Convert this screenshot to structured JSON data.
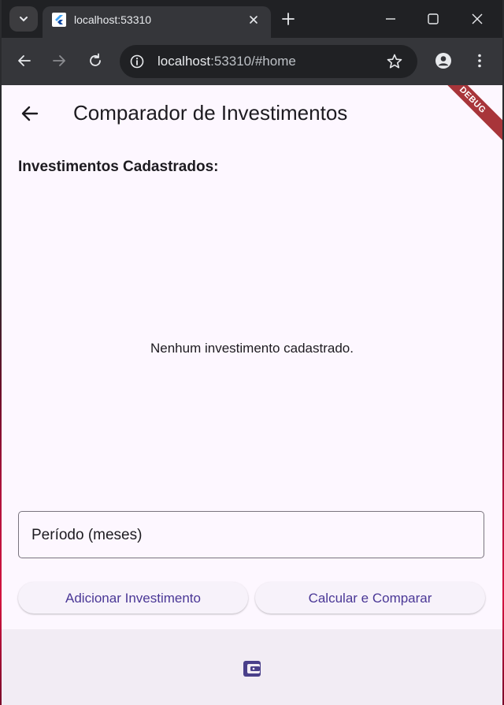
{
  "browser": {
    "tab_title": "localhost:53310",
    "url_host": "localhost",
    "url_rest": ":53310/#home"
  },
  "app": {
    "title": "Comparador de Investimentos",
    "debug_banner": "DEBUG",
    "section_title": "Investimentos Cadastrados:",
    "empty_message": "Nenhum investimento cadastrado.",
    "period_field": {
      "placeholder": "Período (meses)",
      "value": ""
    },
    "buttons": {
      "add": "Adicionar Investimento",
      "calculate": "Calcular e Comparar"
    },
    "bottom_nav": {
      "icon": "wallet-icon"
    }
  },
  "colors": {
    "app_background": "#fdf7ff",
    "button_text": "#4a3796",
    "debug_banner": "#a8353a",
    "bottom_bar": "#f2ecf4",
    "wallet_icon": "#4a3f8a"
  }
}
